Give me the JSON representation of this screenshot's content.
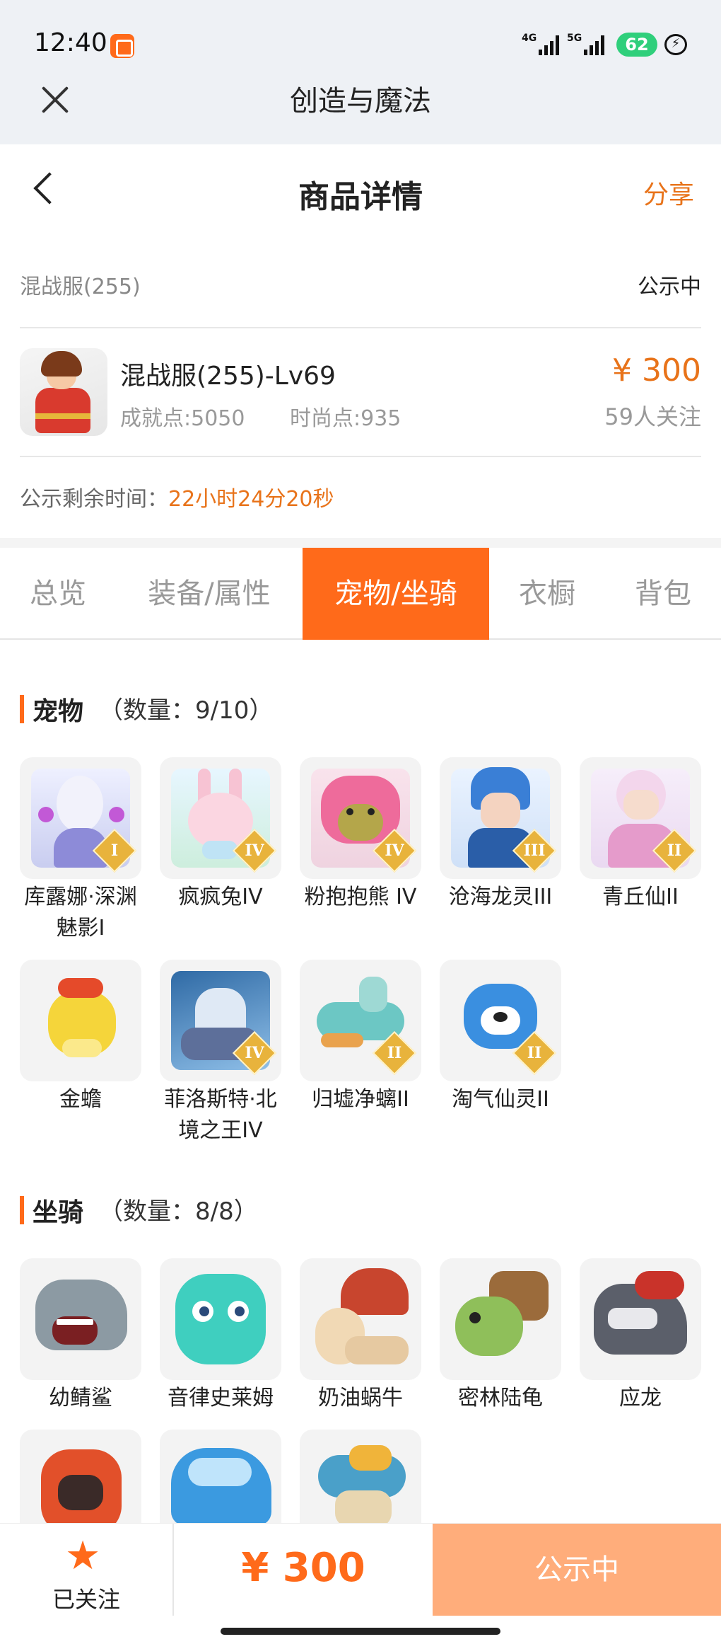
{
  "status_bar": {
    "time": "12:40",
    "net1": "4G",
    "net2": "5G",
    "battery": "62",
    "app_icon": "kuaishou-app-icon",
    "charge_icon": "charging-icon"
  },
  "app_header": {
    "close_icon": "close-icon",
    "title": "创造与魔法"
  },
  "nav": {
    "back_icon": "chevron-left-icon",
    "title": "商品详情",
    "share": "分享"
  },
  "listing": {
    "server": "混战服(255)",
    "status": "公示中",
    "product_title": "混战服(255)-Lv69",
    "achievement": "成就点:5050",
    "fashion": "时尚点:935",
    "price": "¥ 300",
    "followers": "59人关注",
    "timer_label": "公示剩余时间：",
    "timer_value": "22小时24分20秒"
  },
  "tabs": [
    "总览",
    "装备/属性",
    "宠物/坐骑",
    "衣橱",
    "背包"
  ],
  "active_tab": 2,
  "pets": {
    "title": "宠物",
    "count": "（数量：9/10）",
    "items": [
      {
        "name": "库露娜·深渊魅影I",
        "badge": "I"
      },
      {
        "name": "疯疯兔IV",
        "badge": "IV"
      },
      {
        "name": "粉抱抱熊 IV",
        "badge": "IV"
      },
      {
        "name": "沧海龙灵III",
        "badge": "III"
      },
      {
        "name": "青丘仙II",
        "badge": "II"
      },
      {
        "name": "金蟾",
        "badge": ""
      },
      {
        "name": "菲洛斯特·北境之王IV",
        "badge": "IV"
      },
      {
        "name": "归墟净螭II",
        "badge": "II"
      },
      {
        "name": "淘气仙灵II",
        "badge": "II"
      }
    ]
  },
  "mounts": {
    "title": "坐骑",
    "count": "（数量：8/8）",
    "items": [
      {
        "name": "幼鲭鲨"
      },
      {
        "name": "音律史莱姆"
      },
      {
        "name": "奶油蜗牛"
      },
      {
        "name": "密林陆龟"
      },
      {
        "name": "应龙"
      },
      {
        "name": ""
      },
      {
        "name": ""
      },
      {
        "name": ""
      }
    ]
  },
  "bottom_bar": {
    "star_icon": "star-icon",
    "follow_label": "已关注",
    "price": "¥ 300",
    "status_button": "公示中"
  },
  "colors": {
    "accent": "#ff6a1a",
    "price": "#e8731a",
    "muted": "#999999"
  }
}
